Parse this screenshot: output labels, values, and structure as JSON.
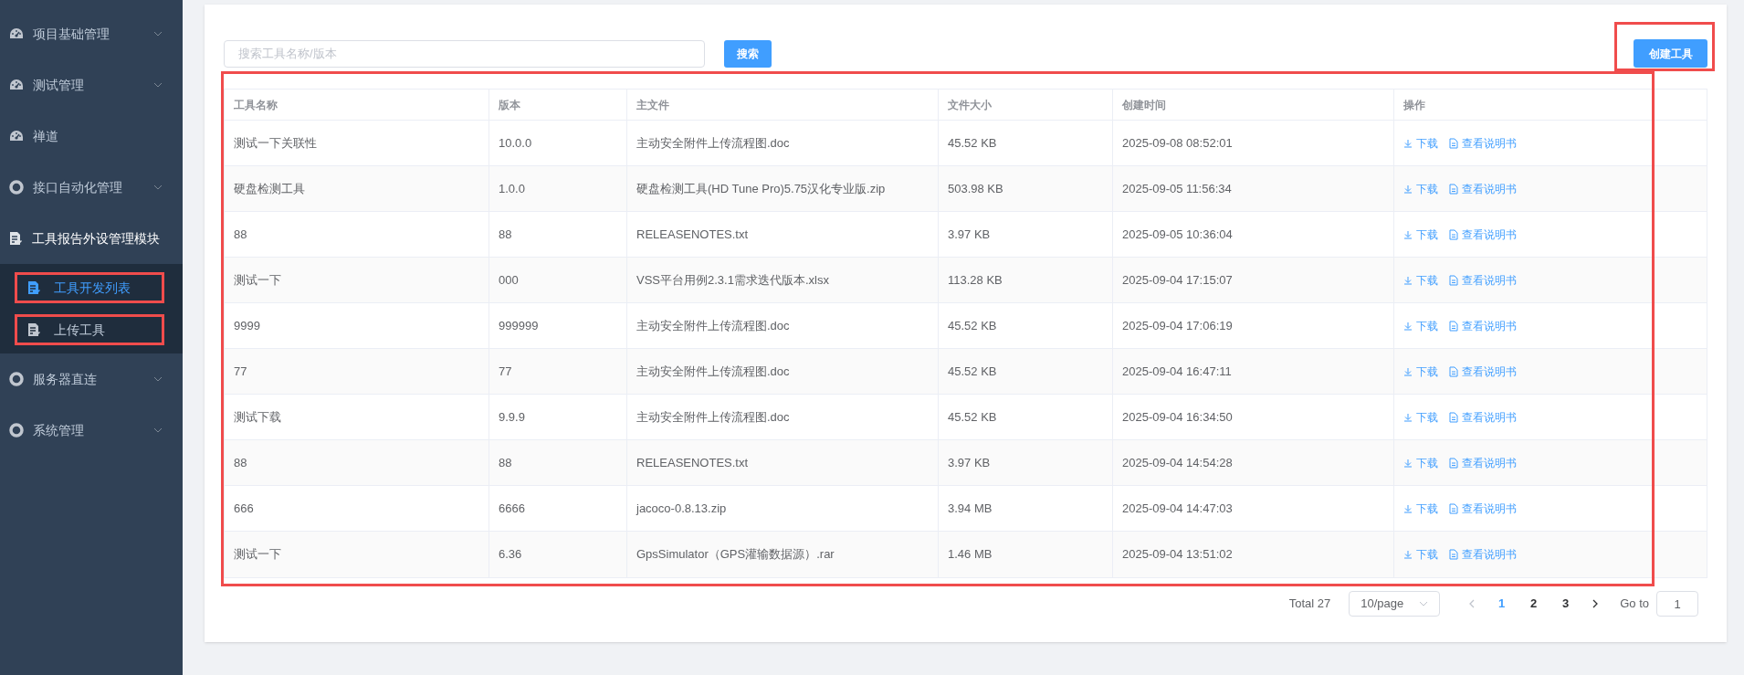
{
  "sidebar": {
    "items": [
      {
        "label": "项目基础管理",
        "kind": "gauge",
        "expanded": false
      },
      {
        "label": "测试管理",
        "kind": "gauge",
        "expanded": false
      },
      {
        "label": "禅道",
        "kind": "gauge"
      },
      {
        "label": "接口自动化管理",
        "kind": "ring",
        "expanded": false
      },
      {
        "label": "工具报告外设管理模块",
        "kind": "doc",
        "expanded": true,
        "children": [
          {
            "label": "工具开发列表",
            "selected": true,
            "highlighted": true
          },
          {
            "label": "上传工具",
            "selected": false,
            "highlighted": true
          }
        ]
      },
      {
        "label": "服务器直连",
        "kind": "ring",
        "expanded": false
      },
      {
        "label": "系统管理",
        "kind": "ring",
        "expanded": false
      }
    ]
  },
  "toolbar": {
    "search": {
      "placeholder": "搜索工具名称/版本"
    },
    "search_button": "搜索",
    "create_button": {
      "label": "创建工具",
      "highlighted": true
    }
  },
  "table": {
    "highlighted": true,
    "columns": [
      "工具名称",
      "版本",
      "主文件",
      "文件大小",
      "创建时间",
      "操作"
    ],
    "rows": [
      {
        "cells": [
          "测试一下关联性",
          "10.0.0",
          "主动安全附件上传流程图.doc",
          "45.52 KB",
          "2025-09-08 08:52:01"
        ],
        "actions": [
          "下载",
          "查看说明书"
        ]
      },
      {
        "cells": [
          "硬盘检测工具",
          "1.0.0",
          "硬盘检测工具(HD Tune Pro)5.75汉化专业版.zip",
          "503.98 KB",
          "2025-09-05 11:56:34"
        ],
        "actions": [
          "下载",
          "查看说明书"
        ]
      },
      {
        "cells": [
          "88",
          "88",
          "RELEASENOTES.txt",
          "3.97 KB",
          "2025-09-05 10:36:04"
        ],
        "actions": [
          "下载",
          "查看说明书"
        ]
      },
      {
        "cells": [
          "测试一下",
          "000",
          "VSS平台用例2.3.1需求迭代版本.xlsx",
          "113.28 KB",
          "2025-09-04 17:15:07"
        ],
        "actions": [
          "下载",
          "查看说明书"
        ]
      },
      {
        "cells": [
          "9999",
          "999999",
          "主动安全附件上传流程图.doc",
          "45.52 KB",
          "2025-09-04 17:06:19"
        ],
        "actions": [
          "下载",
          "查看说明书"
        ]
      },
      {
        "cells": [
          "77",
          "77",
          "主动安全附件上传流程图.doc",
          "45.52 KB",
          "2025-09-04 16:47:11"
        ],
        "actions": [
          "下载",
          "查看说明书"
        ]
      },
      {
        "cells": [
          "测试下载",
          "9.9.9",
          "主动安全附件上传流程图.doc",
          "45.52 KB",
          "2025-09-04 16:34:50"
        ],
        "actions": [
          "下载",
          "查看说明书"
        ]
      },
      {
        "cells": [
          "88",
          "88",
          "RELEASENOTES.txt",
          "3.97 KB",
          "2025-09-04 14:54:28"
        ],
        "actions": [
          "下载",
          "查看说明书"
        ]
      },
      {
        "cells": [
          "666",
          "6666",
          "jacoco-0.8.13.zip",
          "3.94 MB",
          "2025-09-04 14:47:03"
        ],
        "actions": [
          "下载",
          "查看说明书"
        ]
      },
      {
        "cells": [
          "测试一下",
          "6.36",
          "GpsSimulator（GPS灌输数据源）.rar",
          "1.46 MB",
          "2025-09-04 13:51:02"
        ],
        "actions": [
          "下载",
          "查看说明书"
        ]
      }
    ]
  },
  "pagination": {
    "total": "Total 27",
    "page_size": "10/page",
    "prev_disabled": true,
    "pages": [
      {
        "label": "1",
        "selected": true
      },
      {
        "label": "2",
        "selected": false
      },
      {
        "label": "3",
        "selected": false
      }
    ],
    "goto_label": "Go to",
    "goto_value": "1"
  }
}
